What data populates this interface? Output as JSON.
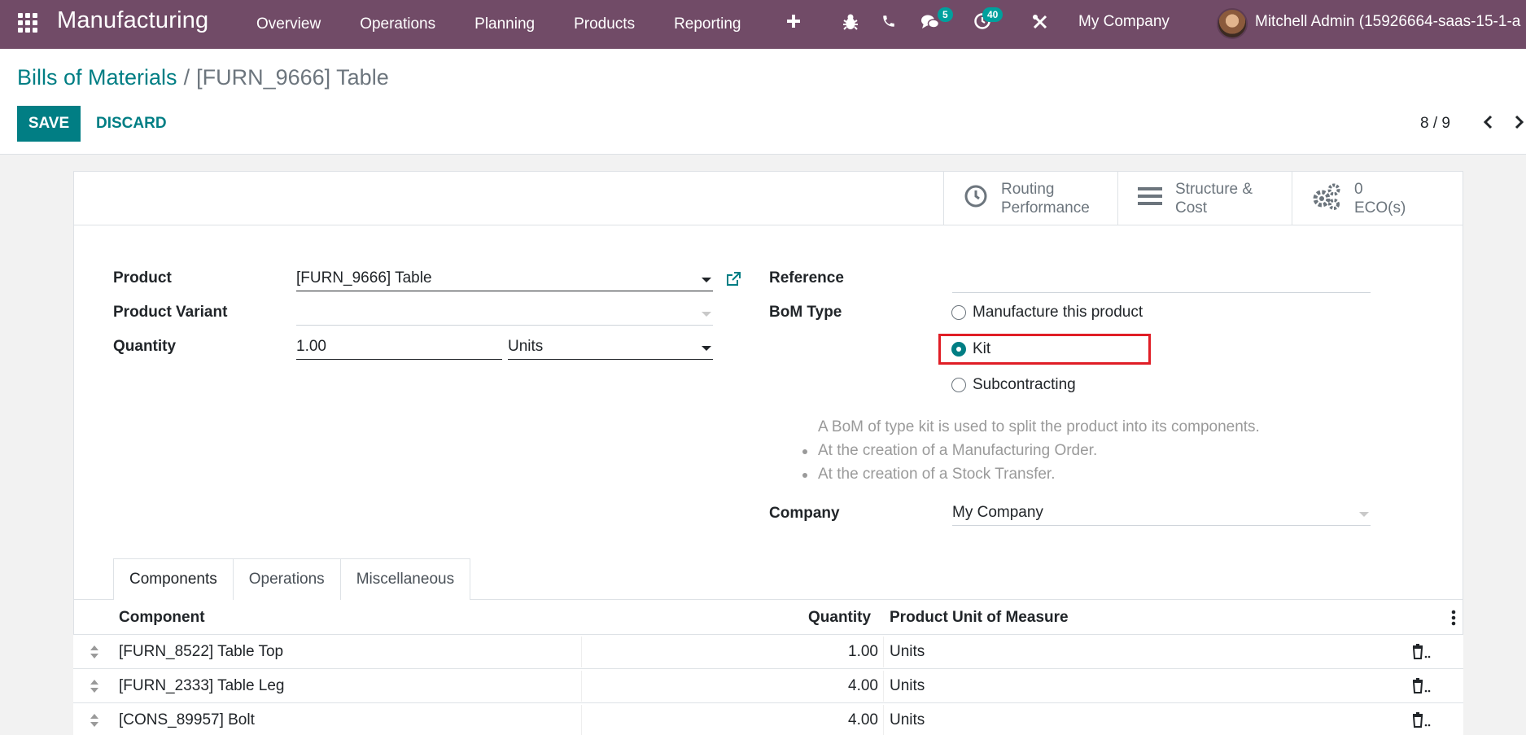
{
  "navbar": {
    "app_title": "Manufacturing",
    "menu": [
      "Overview",
      "Operations",
      "Planning",
      "Products",
      "Reporting"
    ],
    "chat_badge": "5",
    "activity_badge": "40",
    "company": "My Company",
    "user": "Mitchell Admin (15926664-saas-15-1-a"
  },
  "breadcrumb": {
    "parent": "Bills of Materials",
    "separator": "/",
    "current": "[FURN_9666] Table"
  },
  "actions": {
    "save": "SAVE",
    "discard": "DISCARD"
  },
  "pager": {
    "value": "8 / 9"
  },
  "stat_buttons": {
    "routing": {
      "line1": "Routing",
      "line2": "Performance"
    },
    "structure": {
      "line1": "Structure &",
      "line2": "Cost"
    },
    "eco": {
      "line1": "0",
      "line2": "ECO(s)"
    }
  },
  "form": {
    "product_label": "Product",
    "product_value": "[FURN_9666] Table",
    "variant_label": "Product Variant",
    "variant_value": "",
    "quantity_label": "Quantity",
    "quantity_value": "1.00",
    "uom_value": "Units",
    "reference_label": "Reference",
    "reference_value": "",
    "bom_type_label": "BoM Type",
    "bom_type_options": [
      "Manufacture this product",
      "Kit",
      "Subcontracting"
    ],
    "bom_type_selected": "Kit",
    "help_intro": "A BoM of type kit is used to split the product into its components.",
    "help_bullets": [
      "At the creation of a Manufacturing Order.",
      "At the creation of a Stock Transfer."
    ],
    "company_label": "Company",
    "company_value": "My Company"
  },
  "tabs": [
    "Components",
    "Operations",
    "Miscellaneous"
  ],
  "components_table": {
    "headers": {
      "component": "Component",
      "quantity": "Quantity",
      "uom": "Product Unit of Measure"
    },
    "rows": [
      {
        "component": "[FURN_8522] Table Top",
        "quantity": "1.00",
        "uom": "Units"
      },
      {
        "component": "[FURN_2333] Table Leg",
        "quantity": "4.00",
        "uom": "Units"
      },
      {
        "component": "[CONS_89957] Bolt",
        "quantity": "4.00",
        "uom": "Units"
      }
    ]
  },
  "colors": {
    "navbar": "#714B67",
    "primary": "#017e84",
    "badge": "#00A09D",
    "highlight": "#e01e26"
  }
}
